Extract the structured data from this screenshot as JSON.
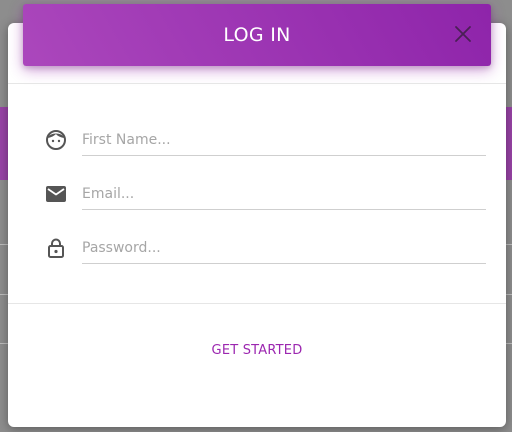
{
  "modal": {
    "title": "LOG IN",
    "close_icon": "close-icon",
    "fields": [
      {
        "icon": "face-icon",
        "placeholder": "First Name...",
        "value": ""
      },
      {
        "icon": "email-icon",
        "placeholder": "Email...",
        "value": ""
      },
      {
        "icon": "lock-icon",
        "placeholder": "Password...",
        "value": ""
      }
    ],
    "submit_label": "GET STARTED"
  },
  "colors": {
    "accent": "#9c27b0",
    "header_start": "#ab47bc",
    "header_end": "#8e24aa",
    "icon": "#555555",
    "placeholder": "#a6a6a6",
    "overlay": "#8d8d8d"
  }
}
